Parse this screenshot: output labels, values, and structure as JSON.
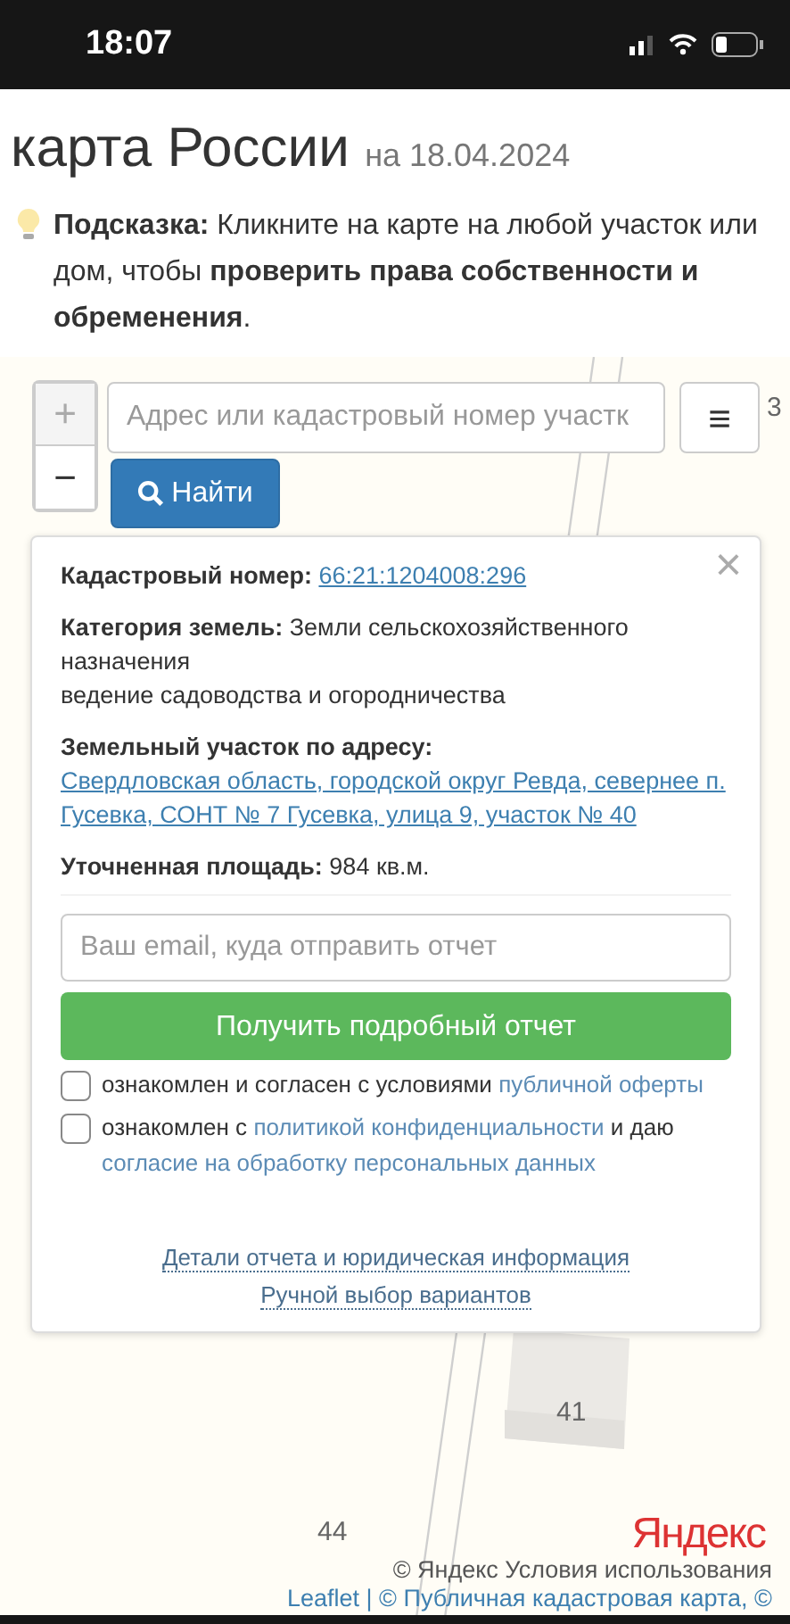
{
  "status_bar": {
    "time": "18:07"
  },
  "header": {
    "title_line_2": "карта России",
    "date": "на 18.04.2024"
  },
  "hint": {
    "text": "**Подсказка:** Кликните на карте на любой участок или дом, чтобы **проверить права собственности и обременения**."
  },
  "map": {
    "zoom_in": "+",
    "zoom_out": "−",
    "search": {
      "placeholder": "Адрес или кадастровый номер участк"
    },
    "search_button": "Найти",
    "menu_button": "≡",
    "labels": [
      {
        "text": "3",
        "kind": "edge"
      },
      {
        "text": "41",
        "kind": "building"
      },
      {
        "text": "44",
        "kind": "plot"
      }
    ],
    "logo": "Яндекс",
    "attribution": [
      "© Яндекс  Условия использования",
      "Leaflet | © Публичная кадастровая карта, ©"
    ]
  },
  "popup": {
    "close": "×",
    "rows": [
      {
        "kind": "link",
        "label": "Кадастровый номер:",
        "value": "66:21:1204008:296"
      },
      {
        "kind": "text",
        "label": "Категория земель:",
        "value": "Земли сельскохозяйственного назначения",
        "extra": "ведение садоводства и огородничества"
      },
      {
        "kind": "link",
        "label": "Земельный участок по адресу:",
        "value": "Свердловская область, городской округ Ревда, севернее п. Гусевка, СОНТ № 7 Гусевка, улица 9, участок № 40"
      },
      {
        "kind": "text",
        "label": "Уточненная площадь:",
        "value": "984 кв.м."
      }
    ],
    "email": {
      "placeholder": "Ваш email, куда отправить отчет"
    },
    "submit": "Получить подробный отчет",
    "agreements": [
      {
        "checked": false,
        "parts": [
          {
            "text": "ознакомлен и согласен с условиями ",
            "kind": "text"
          },
          {
            "text": "публичной оферты",
            "kind": "link"
          }
        ]
      },
      {
        "checked": false,
        "parts": [
          {
            "text": "ознакомлен с ",
            "kind": "text"
          },
          {
            "text": "политикой конфиденциальности",
            "kind": "link"
          },
          {
            "text": " и даю ",
            "kind": "text"
          },
          {
            "text": "согласие на обработку персональных данных",
            "kind": "link"
          }
        ]
      }
    ],
    "footer_links": [
      "Детали отчета и юридическая информация",
      "Ручной выбор вариантов"
    ]
  }
}
